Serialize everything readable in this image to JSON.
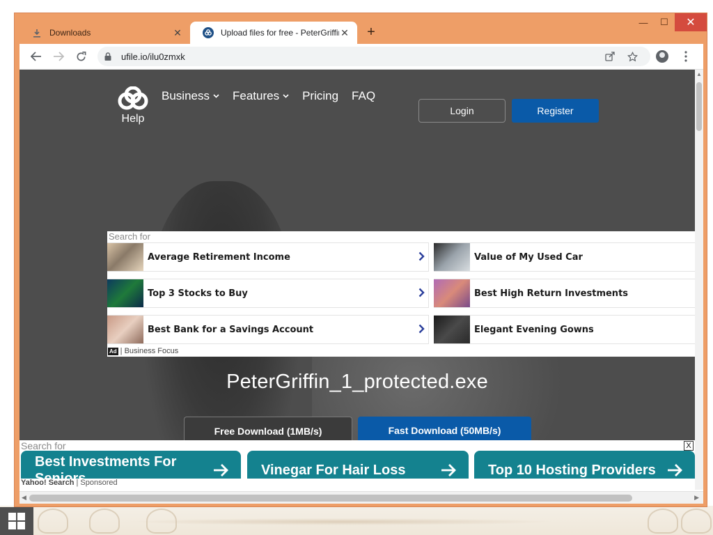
{
  "browser": {
    "tabs": [
      {
        "title": "Downloads",
        "icon": "download-icon",
        "active": false
      },
      {
        "title": "Upload files for free - PeterGriffin",
        "icon": "ufile-logo-icon",
        "active": true
      }
    ],
    "url": "ufile.io/ilu0zmxk",
    "window_controls": {
      "minimize": "—",
      "maximize": "☐",
      "close": "✕"
    }
  },
  "site": {
    "nav": {
      "logo_label": "Help",
      "items": [
        {
          "label": "Business",
          "has_caret": true
        },
        {
          "label": "Features",
          "has_caret": true
        },
        {
          "label": "Pricing",
          "has_caret": false
        },
        {
          "label": "FAQ",
          "has_caret": false
        }
      ],
      "login_label": "Login",
      "register_label": "Register"
    },
    "ad_block": {
      "search_for": "Search for",
      "left_items": [
        {
          "label": "Average Retirement Income"
        },
        {
          "label": "Top 3 Stocks to Buy"
        },
        {
          "label": "Best Bank for a Savings Account"
        }
      ],
      "right_items": [
        {
          "label": "Value of My Used Car"
        },
        {
          "label": "Best High Return Investments"
        },
        {
          "label": "Elegant Evening Gowns"
        }
      ],
      "ad_badge": "Ad",
      "footer": "| Business Focus"
    },
    "file_name": "PeterGriffin_1_protected.exe",
    "free_download_label": "Free Download (1MB/s)",
    "fast_download_label": "Fast Download (50MB/s)",
    "bottom_ad": {
      "search_for": "Search for",
      "close": "X",
      "buttons": [
        {
          "label": "Best Investments For Seniors"
        },
        {
          "label": "Vinegar For Hair Loss"
        },
        {
          "label": "Top 10 Hosting Providers"
        }
      ],
      "footer_brand": "Yahoo! Search",
      "footer_sponsored": "| Sponsored"
    }
  },
  "colors": {
    "window_frame": "#ee9e67",
    "page_bg": "#4d4d4d",
    "primary_blue": "#0a5aa8",
    "ad_teal": "#14828f",
    "chevron": "#2a3e9b"
  }
}
